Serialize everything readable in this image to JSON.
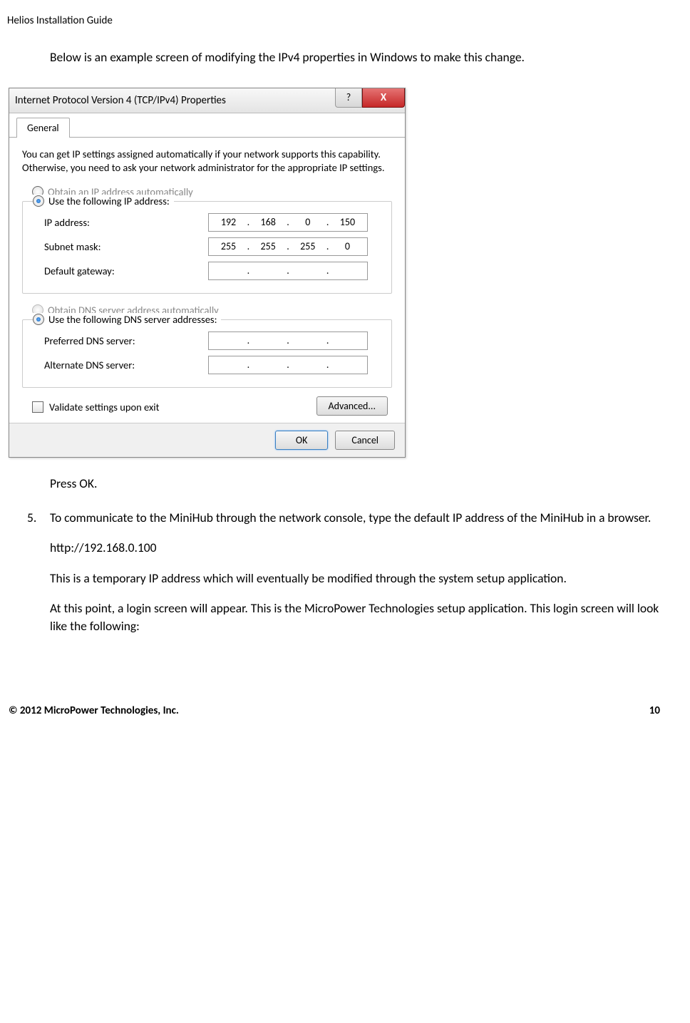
{
  "header": "Helios Installation Guide",
  "intro": "Below is an example screen of modifying the IPv4 properties in Windows to make this change.",
  "dialog": {
    "title": "Internet Protocol Version 4 (TCP/IPv4) Properties",
    "help_glyph": "?",
    "close_glyph": "X",
    "tab": "General",
    "desc": "You can get IP settings assigned automatically if your network supports this capability. Otherwise, you need to ask your network administrator for the appropriate IP settings.",
    "ip_auto": "Obtain an IP address automatically",
    "ip_manual": "Use the following IP address:",
    "ip_label": "IP address:",
    "subnet_label": "Subnet mask:",
    "gateway_label": "Default gateway:",
    "ip_value": [
      "192",
      "168",
      "0",
      "150"
    ],
    "subnet_value": [
      "255",
      "255",
      "255",
      "0"
    ],
    "gateway_value": [
      "",
      "",
      "",
      ""
    ],
    "dns_auto": "Obtain DNS server address automatically",
    "dns_manual": "Use the following DNS server addresses:",
    "pref_dns_label": "Preferred DNS server:",
    "alt_dns_label": "Alternate DNS server:",
    "pref_dns_value": [
      "",
      "",
      "",
      ""
    ],
    "alt_dns_value": [
      "",
      "",
      "",
      ""
    ],
    "validate": "Validate settings upon exit",
    "advanced": "Advanced...",
    "ok": "OK",
    "cancel": "Cancel"
  },
  "press_ok": "Press OK.",
  "step5": {
    "num": "5.",
    "p1": "To communicate to the MiniHub through the network console, type the default IP address of the MiniHub in a browser.",
    "url": "http://192.168.0.100",
    "p2": "This is a temporary IP address which will eventually be modified through the system setup application.",
    "p3": "At this point, a login screen will appear.   This is the MicroPower Technologies setup application.  This login screen will look like the following:"
  },
  "footer": {
    "copyright": "© 2012 MicroPower Technologies, Inc.",
    "page": "10"
  }
}
